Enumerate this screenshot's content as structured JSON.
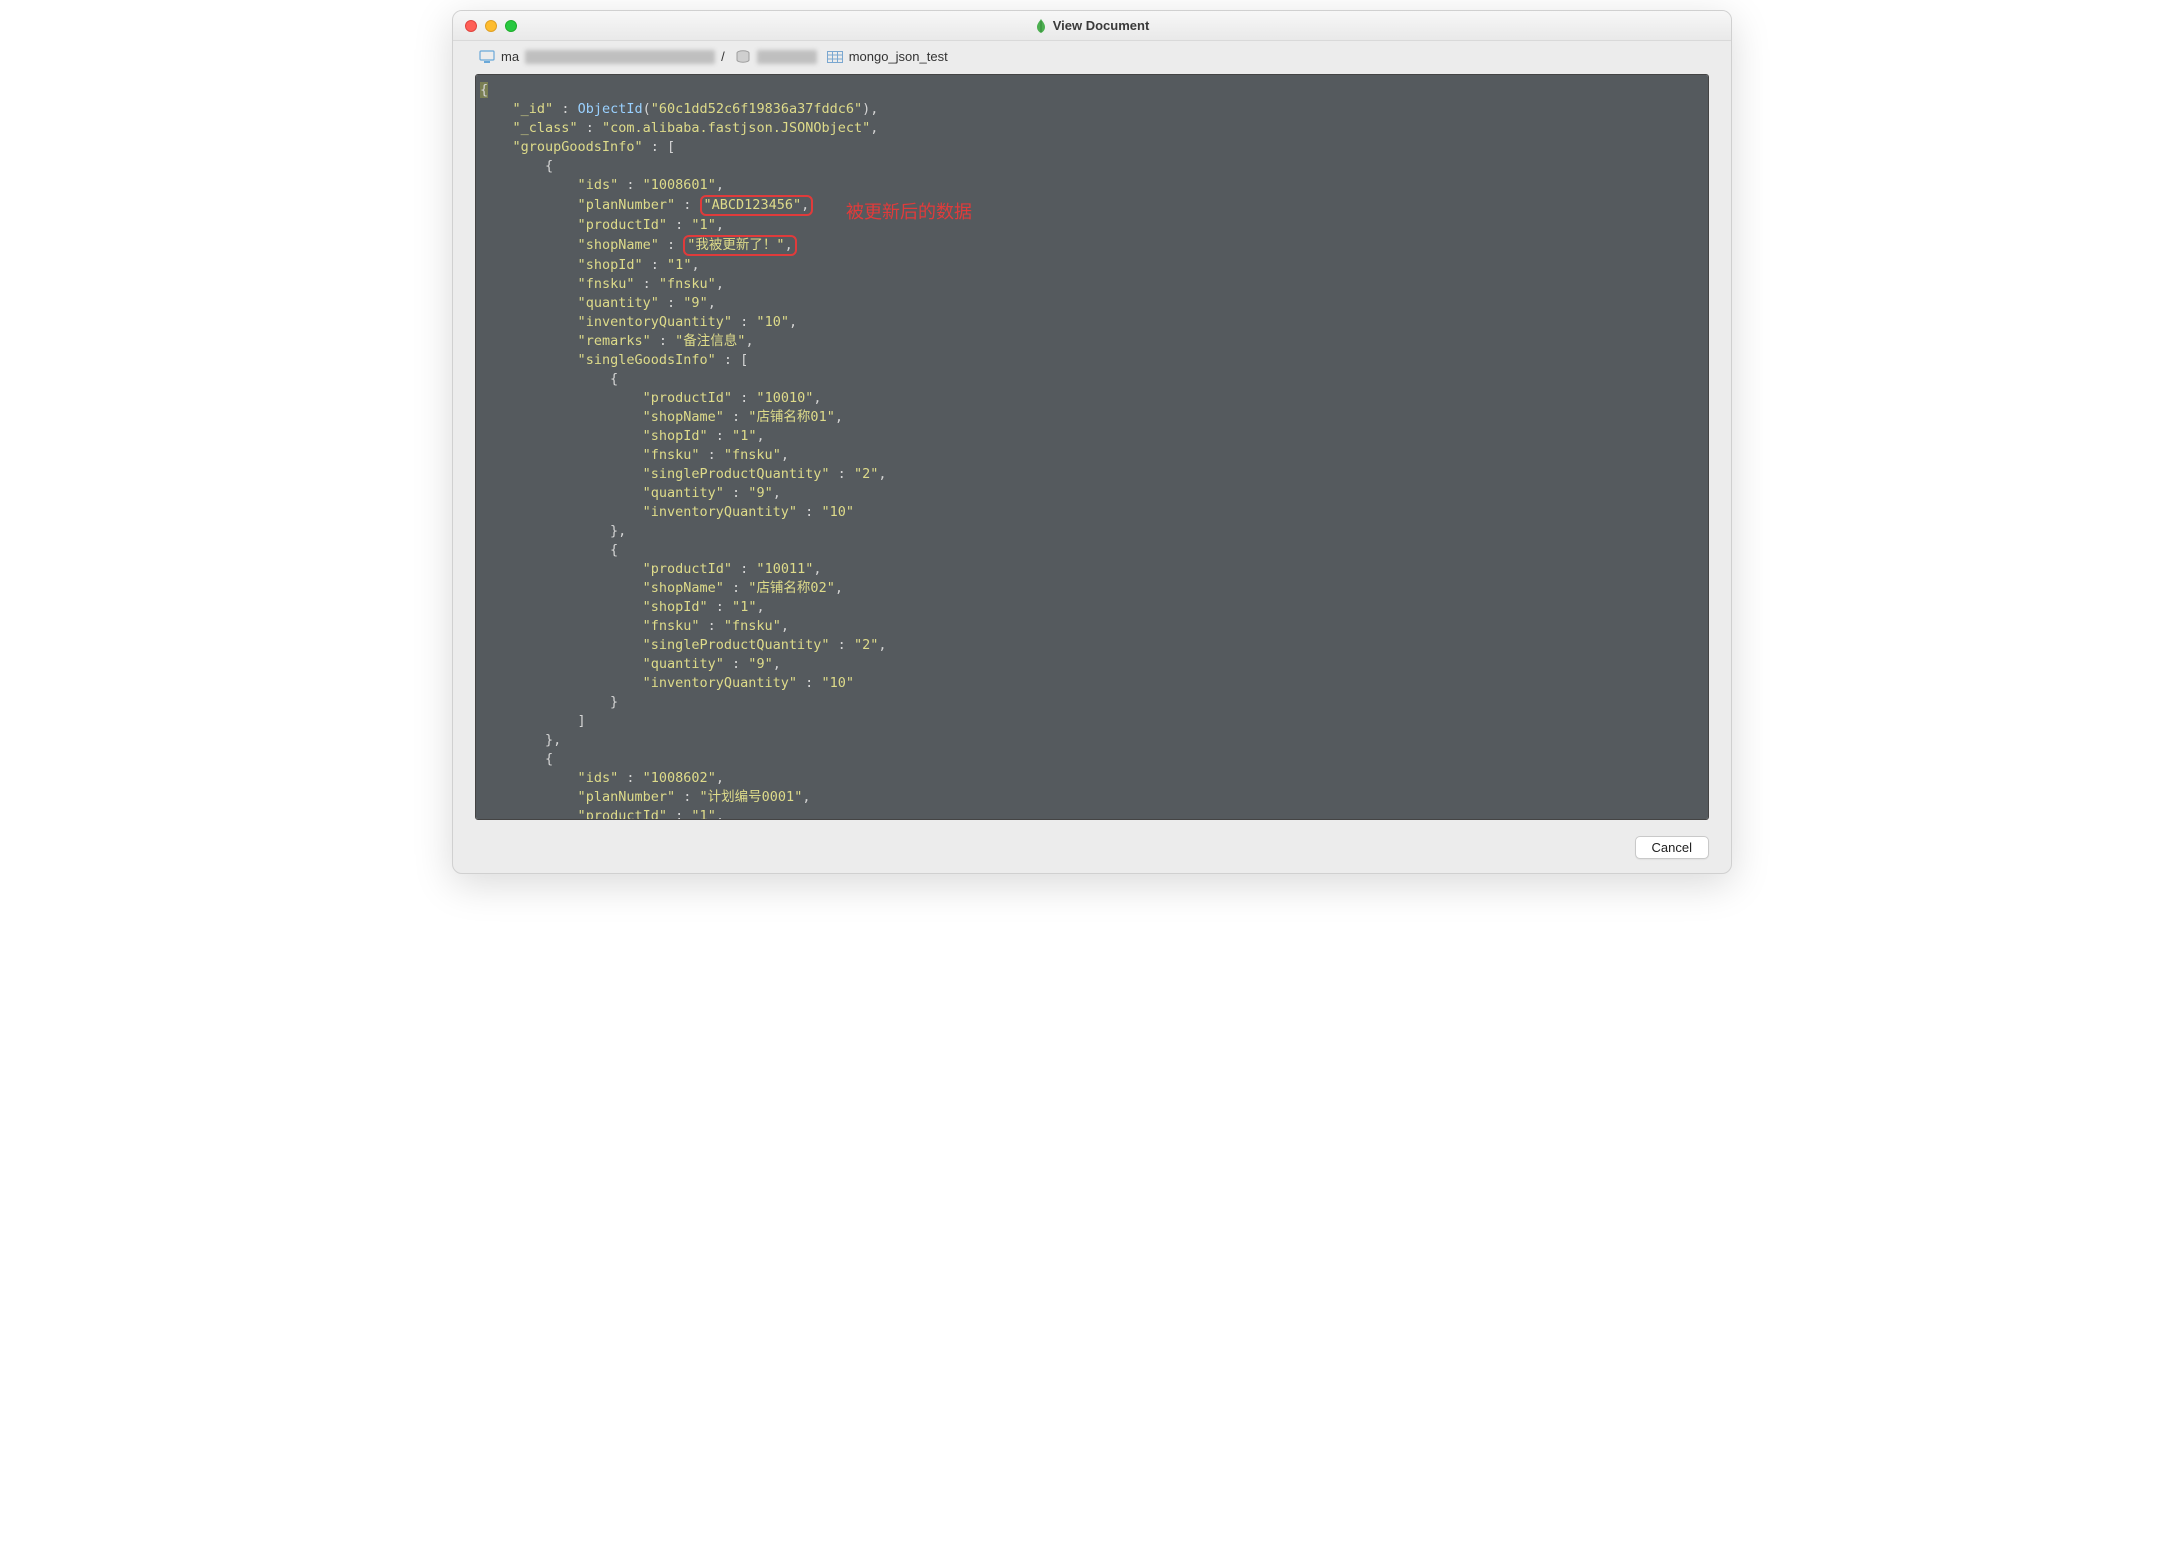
{
  "window": {
    "title": "View Document"
  },
  "breadcrumb": {
    "host_prefix": "ma",
    "sep": "/",
    "collection": "mongo_json_test"
  },
  "annotation": {
    "label": "被更新后的数据"
  },
  "doc": {
    "_id_fn": "ObjectId",
    "_id_val": "60c1dd52c6f19836a37fddc6",
    "_class": "com.alibaba.fastjson.JSONObject",
    "groupGoodsInfo_key": "groupGoodsInfo",
    "g0": {
      "ids": "1008601",
      "planNumber_key": "planNumber",
      "planNumber": "ABCD123456",
      "productId": "1",
      "shopName_key": "shopName",
      "shopName": "我被更新了！",
      "shopId": "1",
      "fnsku": "fnsku",
      "quantity": "9",
      "inventoryQuantity": "10",
      "remarks": "备注信息",
      "singleGoodsInfo_key": "singleGoodsInfo",
      "s0": {
        "productId": "10010",
        "shopName": "店铺名称01",
        "shopId": "1",
        "fnsku": "fnsku",
        "singleProductQuantity": "2",
        "quantity": "9",
        "inventoryQuantity": "10"
      },
      "s1": {
        "productId": "10011",
        "shopName": "店铺名称02",
        "shopId": "1",
        "fnsku": "fnsku",
        "singleProductQuantity": "2",
        "quantity": "9",
        "inventoryQuantity": "10"
      }
    },
    "g1": {
      "ids": "1008602",
      "planNumber": "计划编号0001",
      "productId": "1"
    }
  },
  "footer": {
    "cancel": "Cancel"
  },
  "labels": {
    "_id": "_id",
    "_class": "_class",
    "ids": "ids",
    "productId": "productId",
    "shopId": "shopId",
    "fnsku": "fnsku",
    "quantity": "quantity",
    "inventoryQuantity": "inventoryQuantity",
    "remarks": "remarks",
    "shopName": "shopName",
    "singleProductQuantity": "singleProductQuantity",
    "planNumber": "planNumber"
  }
}
